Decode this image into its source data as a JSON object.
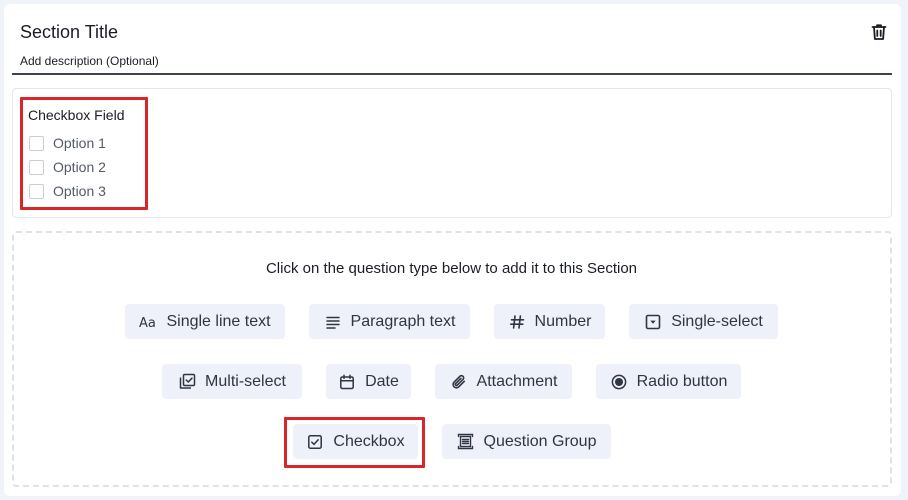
{
  "section": {
    "title": "Section Title",
    "description": "Add description (Optional)",
    "delete_icon": "trash-icon"
  },
  "field": {
    "label": "Checkbox Field",
    "options": [
      "Option 1",
      "Option 2",
      "Option 3"
    ]
  },
  "picker": {
    "instruction": "Click on the question type below to add it to this Section",
    "types": [
      {
        "label": "Single line text",
        "icon": "text-aa-icon"
      },
      {
        "label": "Paragraph text",
        "icon": "paragraph-lines-icon"
      },
      {
        "label": "Number",
        "icon": "hash-icon"
      },
      {
        "label": "Single-select",
        "icon": "dropdown-box-icon"
      },
      {
        "label": "Multi-select",
        "icon": "multi-check-icon"
      },
      {
        "label": "Date",
        "icon": "calendar-icon"
      },
      {
        "label": "Attachment",
        "icon": "paperclip-icon"
      },
      {
        "label": "Radio button",
        "icon": "radio-icon"
      },
      {
        "label": "Checkbox",
        "icon": "checkbox-icon"
      },
      {
        "label": "Question Group",
        "icon": "group-icon"
      }
    ]
  },
  "colors": {
    "highlight": "#d8262b",
    "button_bg": "#eef1f9",
    "page_bg": "#f0f3fa"
  }
}
